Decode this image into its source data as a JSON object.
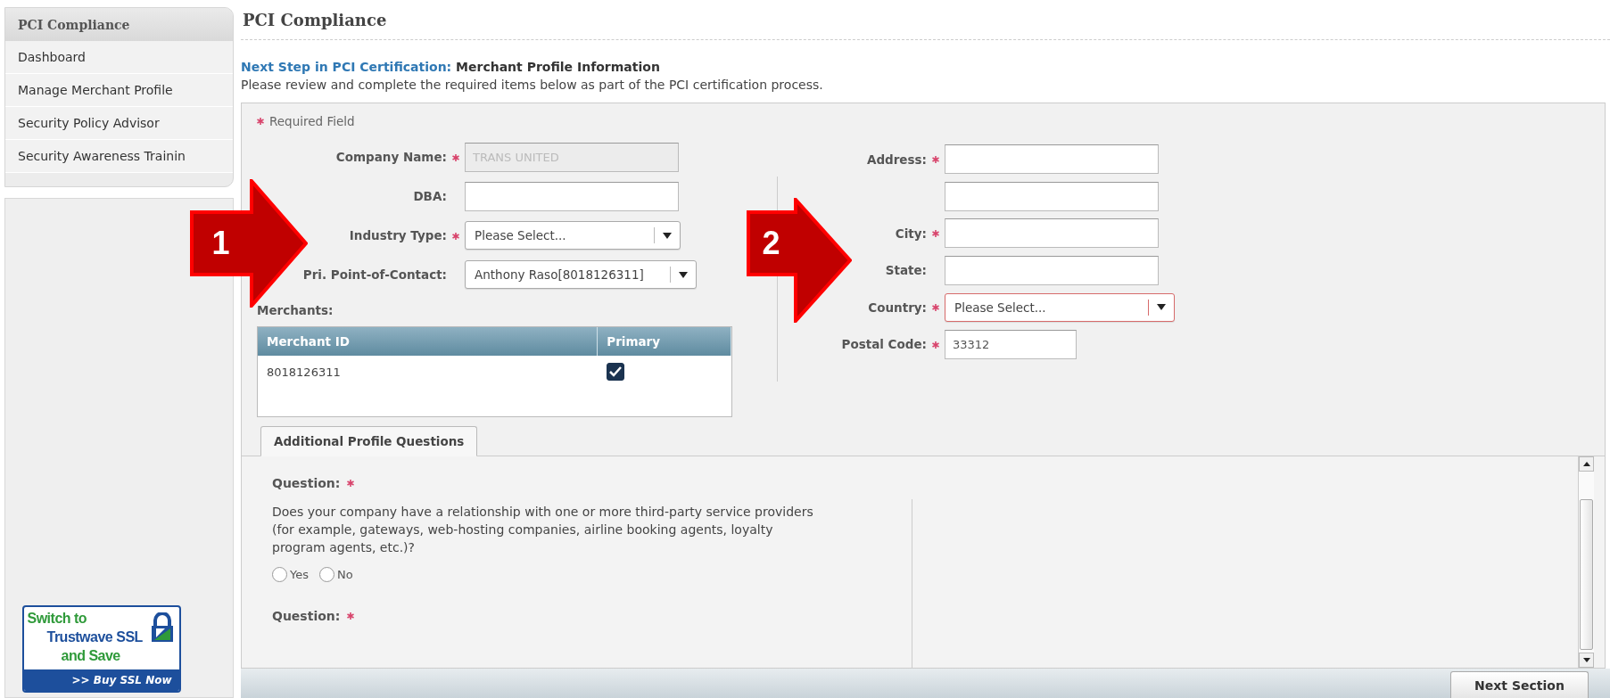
{
  "sidebar": {
    "title": "PCI Compliance",
    "items": [
      {
        "label": "Dashboard",
        "selected": false
      },
      {
        "label": "Manage Merchant Profile",
        "selected": false
      },
      {
        "label": "Security Policy Advisor",
        "selected": false
      },
      {
        "label": "Security Awareness Trainin",
        "selected": false
      }
    ],
    "ad": {
      "lines": [
        {
          "text": "Switch to",
          "color": "#2f9a3a"
        },
        {
          "text": "Trustwave SSL",
          "color": "#1d4f9c"
        },
        {
          "text": "and Save",
          "color": "#2f9a3a"
        }
      ],
      "button": ">> Buy SSL Now"
    }
  },
  "page": {
    "title": "PCI Compliance",
    "next_step_label": "Next Step in PCI Certification:",
    "next_step_value": "Merchant Profile Information",
    "description": "Please review and complete the required items below as part of the PCI certification process."
  },
  "form": {
    "required_note": "Required Field",
    "left_fields": [
      {
        "label": "Company Name:",
        "required": true,
        "kind": "text",
        "value": "TRANS UNITED",
        "disabled": true
      },
      {
        "label": "DBA:",
        "required": false,
        "kind": "text",
        "disabled": false
      },
      {
        "label": "Industry Type:",
        "required": true,
        "kind": "select",
        "value": "Please Select...",
        "error": false
      },
      {
        "label": "Pri. Point-of-Contact:",
        "required": false,
        "kind": "select",
        "value": "Anthony Raso[8018126311]",
        "error": false
      }
    ],
    "merchants": {
      "label": "Merchants:",
      "columns": [
        "Merchant ID",
        "Primary"
      ],
      "rows": [
        {
          "merchant_id": "8018126311",
          "primary": true
        }
      ]
    },
    "right_fields": [
      {
        "label": "Address:",
        "required": true,
        "kind": "text",
        "disabled": false
      },
      {
        "required": false,
        "kind": "text",
        "disabled": false
      },
      {
        "label": "City:",
        "required": true,
        "kind": "text",
        "disabled": false
      },
      {
        "label": "State:",
        "required": false,
        "kind": "text",
        "disabled": false
      },
      {
        "label": "Country:",
        "required": true,
        "kind": "select",
        "value": "Please Select...",
        "error": true
      },
      {
        "label": "Postal Code:",
        "required": true,
        "kind": "text",
        "value": "33312",
        "disabled": false,
        "short": true
      }
    ]
  },
  "tabs": [
    {
      "label": "Additional Profile Questions",
      "selected": true
    }
  ],
  "questions": [
    {
      "label": "Question:",
      "required": true,
      "text": "Does your company have a relationship with one or more third-party service providers (for example, gateways, web-hosting companies, airline booking agents, loyalty program agents, etc.)?",
      "options": [
        {
          "label": "Yes",
          "selected": false
        },
        {
          "label": "No",
          "selected": false
        }
      ]
    },
    {
      "label": "Question:",
      "required": true
    }
  ],
  "annotations": [
    {
      "label": "1"
    },
    {
      "label": "2"
    }
  ],
  "next_button": "Next Section"
}
